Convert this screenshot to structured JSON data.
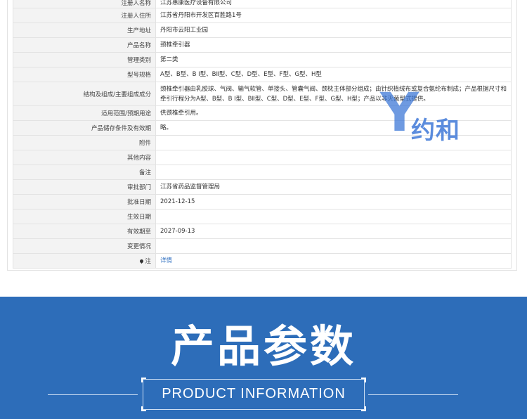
{
  "registration": {
    "rows": [
      {
        "label": "注册人名称",
        "value": "江苏惠康医疗设备有限公司",
        "row_height": 8
      },
      {
        "label": "注册人住所",
        "value": "江苏省丹阳市开发区百胜路1号",
        "row_height": 21
      },
      {
        "label": "生产地址",
        "value": "丹阳市云阳工业园",
        "row_height": 21
      },
      {
        "label": "产品名称",
        "value": "颈椎牵引器",
        "row_height": 21
      },
      {
        "label": "管理类别",
        "value": "第二类",
        "row_height": 21
      },
      {
        "label": "型号规格",
        "value": "A型、B型、B Ⅰ型、BⅡ型、C型、D型、E型、F型、G型、H型",
        "row_height": 21
      },
      {
        "label": "结构及组成/主要组成成分",
        "value": "颈椎牵引器由乳胶球、气阀、输气软管、单接头、管囊气阀、颈枕主体部分组成；由针织植绒布或复合氨纶布制成；产品根据尺寸和牵引行程分为A型、B型、B Ⅰ型、BⅡ型、C型、D型、E型、F型、G型、H型；产品以非灭菌型式提供。",
        "row_height": 34
      },
      {
        "label": "适用范围/预期用途",
        "value": "供颈椎牵引用。",
        "row_height": 21
      },
      {
        "label": "产品储存条件及有效期",
        "value": "略。",
        "row_height": 21
      },
      {
        "label": "附件",
        "value": "",
        "row_height": 21
      },
      {
        "label": "其他内容",
        "value": "",
        "row_height": 21
      },
      {
        "label": "备注",
        "value": "",
        "row_height": 21
      },
      {
        "label": "审批部门",
        "value": "江苏省药品监督管理局",
        "row_height": 21
      },
      {
        "label": "批准日期",
        "value": "2021-12-15",
        "row_height": 21
      },
      {
        "label": "生效日期",
        "value": "",
        "row_height": 21
      },
      {
        "label": "有效期至",
        "value": "2027-09-13",
        "row_height": 21
      },
      {
        "label": "变更情况",
        "value": "",
        "row_height": 21
      }
    ],
    "note": {
      "label": "注",
      "link_text": "详情",
      "icon": "pin-icon"
    }
  },
  "watermark": {
    "letter": "Y",
    "text": "约和"
  },
  "banner": {
    "title": "产品参数",
    "subtitle": "PRODUCT INFORMATION"
  },
  "colors": {
    "banner_bg": "#2d6db9",
    "link": "#2f6fc0",
    "watermark": "#3e78d7"
  }
}
